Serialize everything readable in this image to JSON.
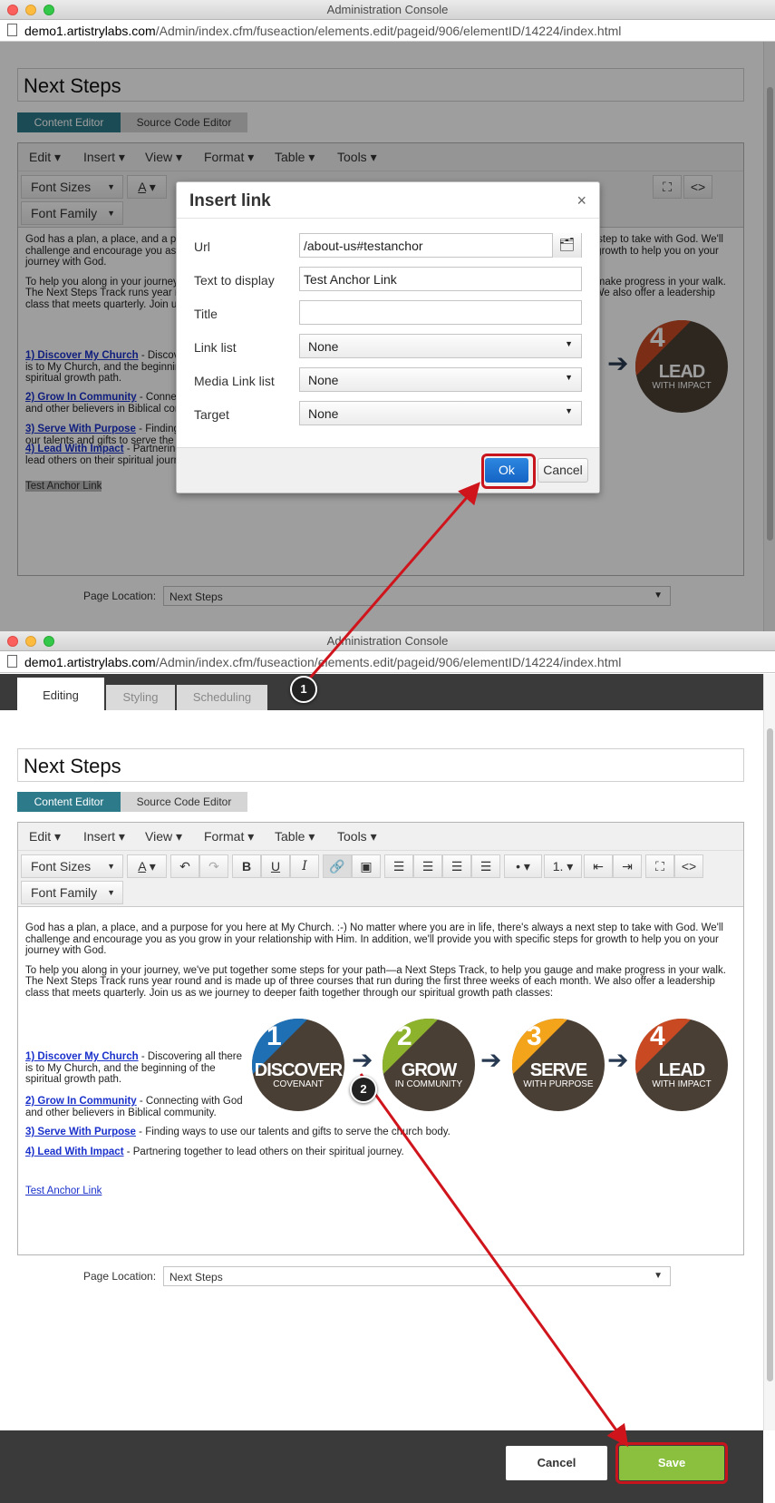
{
  "window": {
    "title": "Administration Console",
    "url_host": "demo1.artistrylabs.com",
    "url_path": "/Admin/index.cfm/fuseaction/elements.edit/pageid/906/elementID/14224/index.html"
  },
  "editor": {
    "title_value": "Next Steps",
    "tabs": [
      "Content Editor",
      "Source Code Editor"
    ],
    "menu": [
      "Edit",
      "Insert",
      "View",
      "Format",
      "Table",
      "Tools"
    ],
    "font_sizes_label": "Font Sizes",
    "font_family_label": "Font Family",
    "font_color_glyph": "A",
    "bold_glyph": "B",
    "underline_glyph": "U",
    "italic_glyph": "I",
    "paragraph1": "God has a plan, a place, and a purpose for you here at My Church. :-) No matter where you are in life, there's always a next step to take with God. We'll challenge and encourage you as you grow in your relationship with Him. In addition, we'll provide you with specific steps for growth to help you on your journey with God.",
    "paragraph2": "To help you along in your journey, we've put together some steps for your path—a Next Steps Track, to help you gauge and make progress in your walk. The Next Steps Track runs year round and is made up of three courses that run during the first three weeks of each month. We also offer a leadership class that meets quarterly. Join us as we journey to deeper faith together through our spiritual growth path classes:",
    "steps": [
      {
        "link": "1) Discover My Church",
        "text": " - Discovering all there is to My Church, and the beginning of the spiritual growth path."
      },
      {
        "link": "2) Grow In Community",
        "text": " - Connecting with God and other believers in Biblical community."
      },
      {
        "link": "3) Serve With Purpose",
        "text": " - Finding ways to use our talents and gifts to serve the church body."
      },
      {
        "link": "4) Lead With Impact",
        "text": " - Partnering together to lead others on their spiritual journey."
      }
    ],
    "anchor_text": "Test Anchor Link",
    "circles": [
      {
        "num": "1",
        "big": "DISCOVER",
        "small": "COVENANT",
        "color": "#1f6fb5"
      },
      {
        "num": "2",
        "big": "GROW",
        "small": "IN COMMUNITY",
        "color": "#8db32c"
      },
      {
        "num": "3",
        "big": "SERVE",
        "small": "WITH PURPOSE",
        "color": "#f3a41b"
      },
      {
        "num": "4",
        "big": "LEAD",
        "small": "WITH IMPACT",
        "color": "#c94a22"
      }
    ],
    "page_location_label": "Page Location:",
    "page_location_value": "Next Steps"
  },
  "dialog": {
    "title": "Insert link",
    "close": "×",
    "url_label": "Url",
    "url_value": "/about-us#testanchor",
    "text_label": "Text to display",
    "text_value": "Test Anchor Link",
    "title_label": "Title",
    "title_value": "",
    "link_list_label": "Link list",
    "link_list_value": "None",
    "media_label": "Media Link list",
    "media_value": "None",
    "target_label": "Target",
    "target_value": "None",
    "ok": "Ok",
    "cancel": "Cancel"
  },
  "content_tabs": [
    "Editing",
    "Styling",
    "Scheduling"
  ],
  "footer": {
    "cancel": "Cancel",
    "save": "Save"
  },
  "markers": [
    "1",
    "2"
  ],
  "colors": {
    "accent_teal": "#2c7a8a",
    "ok_blue": "#1463c4",
    "save_green": "#8bc03e",
    "annotation_red": "#c8141c",
    "dark_bar": "#3a3a3a"
  }
}
